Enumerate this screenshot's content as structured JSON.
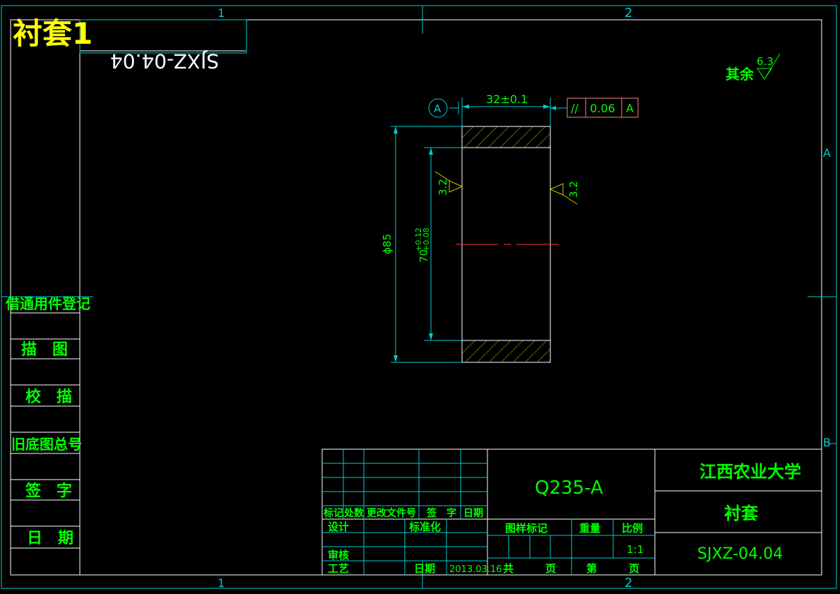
{
  "drawing": {
    "title_overlay": "衬套1",
    "code_mirrored": "SJXZ-04.04",
    "zone_numbers_top": [
      "1",
      "2"
    ],
    "zone_numbers_bottom": [
      "1",
      "2"
    ],
    "zone_letters": [
      "A",
      "B"
    ],
    "roughness_note": {
      "prefix": "其余",
      "value": "6.3"
    }
  },
  "left_strip": {
    "header": "借通用件登记",
    "rows": [
      "描　图",
      "校　描",
      "旧底图总号",
      "签　字",
      "日　期"
    ]
  },
  "part_view": {
    "datum": "A",
    "length_dim": "32±0.1",
    "tolerance_frame": {
      "symbol": "//",
      "value": "0.06",
      "datum": "A"
    },
    "outer_diameter": "ϕ85",
    "inner_dim_base": "70",
    "inner_dim_upper": "+0.12",
    "inner_dim_lower": "+0.08",
    "roughness_left": "3.2",
    "roughness_right": "3.2"
  },
  "title_block": {
    "material": "Q235-A",
    "university": "江西农业大学",
    "part_name": "衬套",
    "drawing_number": "SJXZ-04.04",
    "rev_headers": [
      "标记",
      "处数",
      "更改文件号",
      "签　字",
      "日期"
    ],
    "design": "设计",
    "standardize": "标准化",
    "review": "审核",
    "process": "工艺",
    "date_label": "日期",
    "date_value": "2013.03.16",
    "stage_label": "图样标记",
    "weight_label": "重量",
    "scale_label": "比例",
    "scale_value": "1:1",
    "total_label": "共",
    "sheet_label": "页",
    "page_label": "第",
    "page_suffix": "页"
  }
}
